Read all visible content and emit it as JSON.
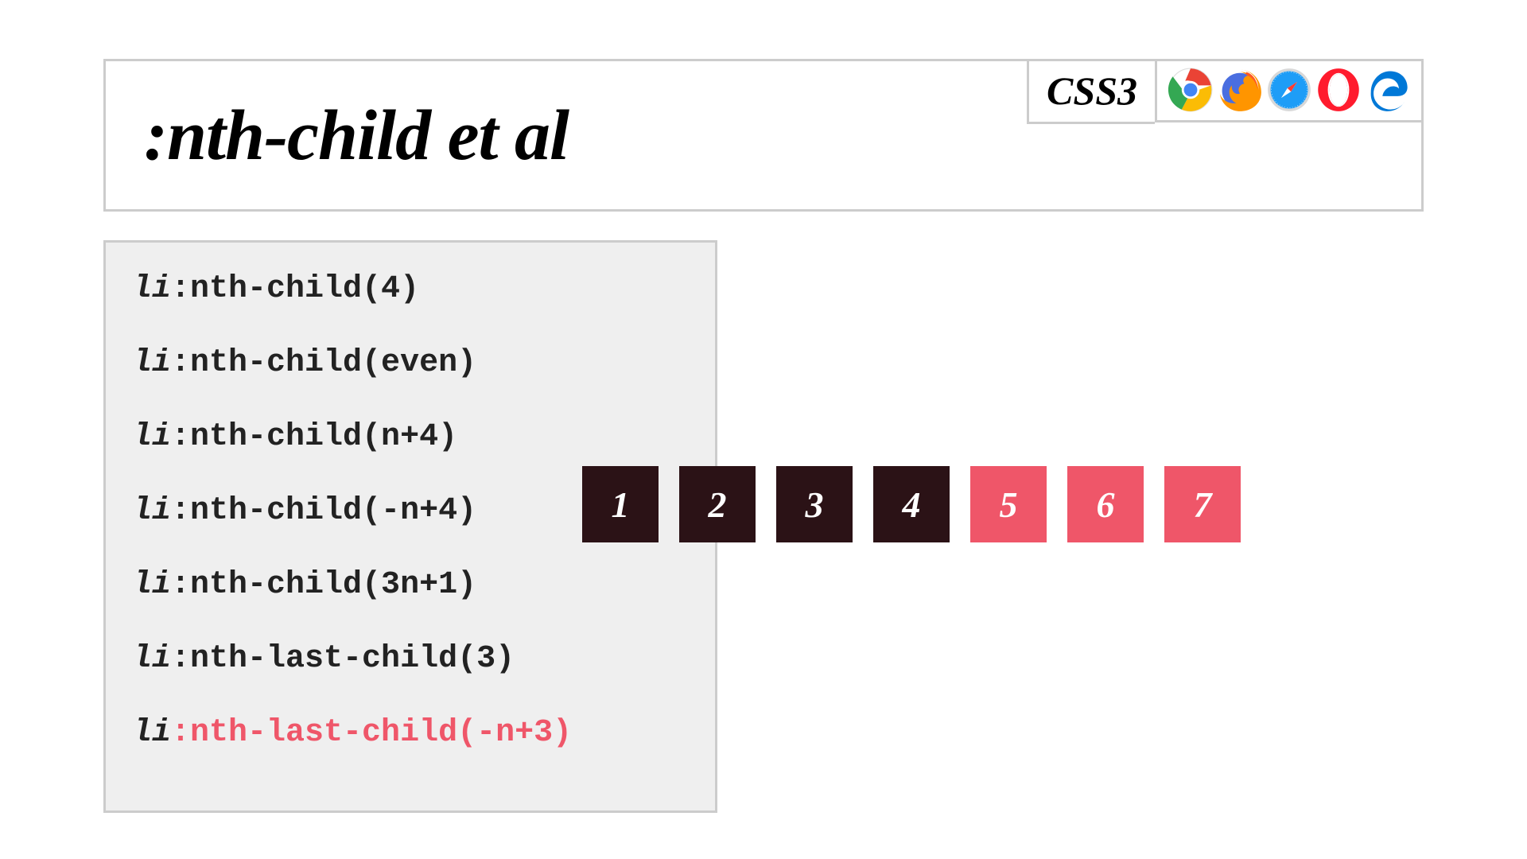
{
  "header": {
    "title": ":nth-child et al",
    "spec_badge": "CSS3",
    "browser_icons": [
      {
        "name": "chrome-icon"
      },
      {
        "name": "firefox-icon"
      },
      {
        "name": "safari-icon"
      },
      {
        "name": "opera-icon"
      },
      {
        "name": "edge-icon"
      }
    ]
  },
  "code": {
    "element_label": "li",
    "lines": [
      {
        "selector": ":nth-child(4)",
        "active": false
      },
      {
        "selector": ":nth-child(even)",
        "active": false
      },
      {
        "selector": ":nth-child(n+4)",
        "active": false
      },
      {
        "selector": ":nth-child(-n+4)",
        "active": false
      },
      {
        "selector": ":nth-child(3n+1)",
        "active": false
      },
      {
        "selector": ":nth-last-child(3)",
        "active": false
      },
      {
        "selector": ":nth-last-child(-n+3)",
        "active": true
      }
    ]
  },
  "boxes": {
    "items": [
      {
        "label": "1",
        "matched": false
      },
      {
        "label": "2",
        "matched": false
      },
      {
        "label": "3",
        "matched": false
      },
      {
        "label": "4",
        "matched": false
      },
      {
        "label": "5",
        "matched": true
      },
      {
        "label": "6",
        "matched": true
      },
      {
        "label": "7",
        "matched": true
      }
    ],
    "colors": {
      "matched": "#ef5669",
      "unmatched": "#2b1216"
    }
  }
}
